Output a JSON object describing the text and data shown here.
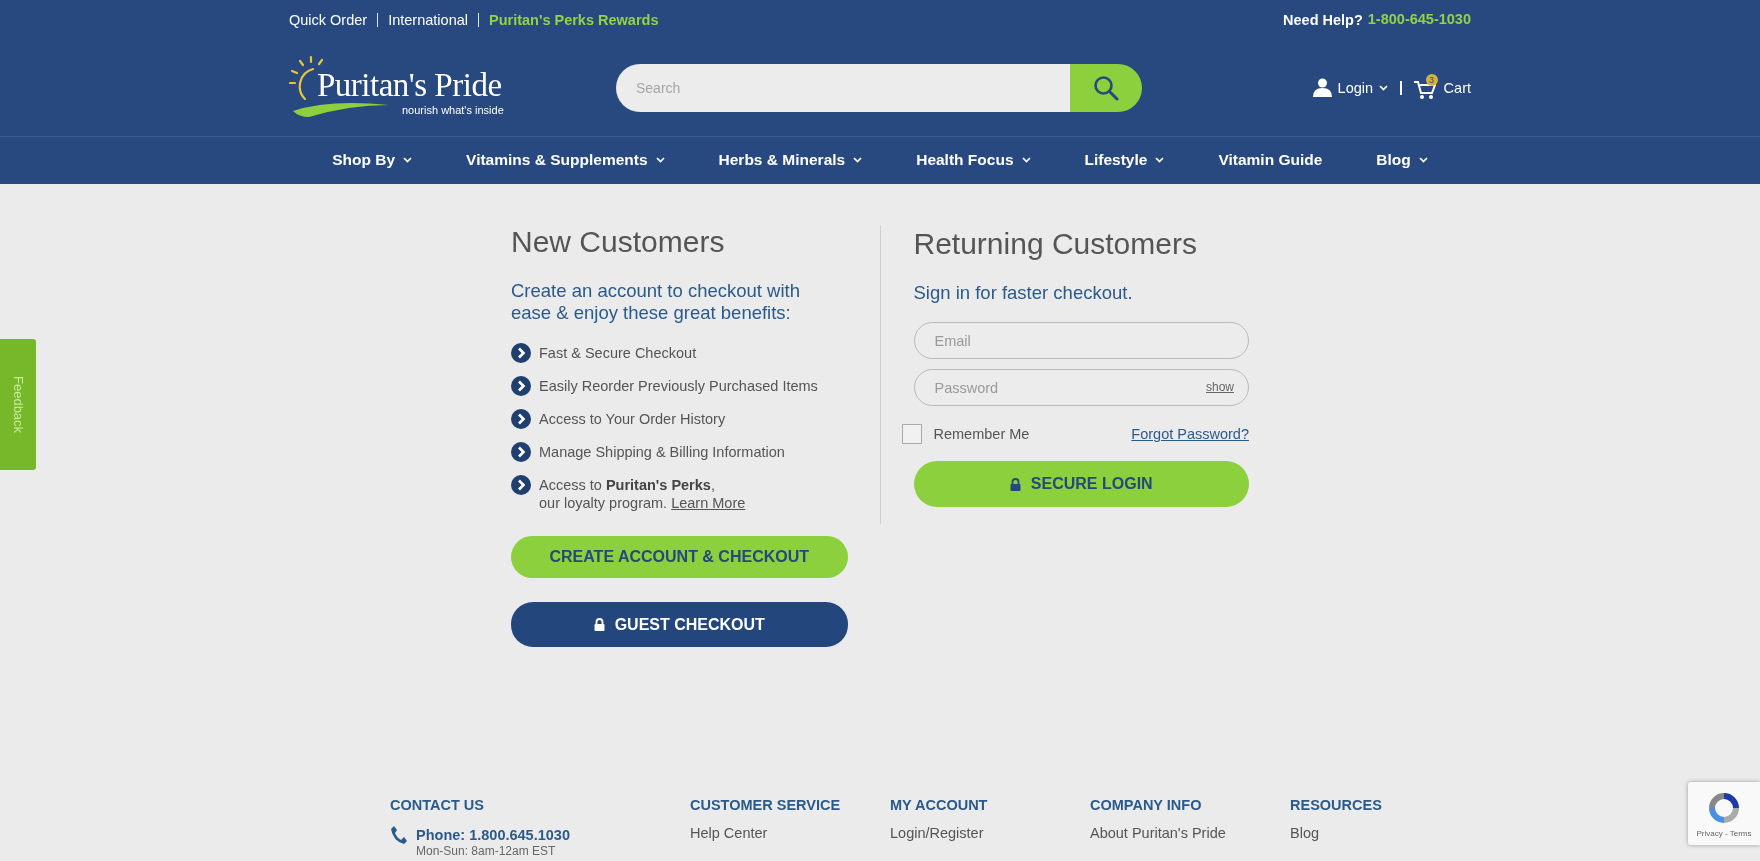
{
  "top_bar": {
    "links": [
      {
        "label": "Quick Order",
        "highlight": false
      },
      {
        "label": "International",
        "highlight": false
      },
      {
        "label": "Puritan's Perks Rewards",
        "highlight": true
      }
    ],
    "help_label": "Need Help?",
    "phone": "1-800-645-1030"
  },
  "header": {
    "logo": {
      "name": "Puritan's Pride",
      "tagline": "nourish what's inside"
    },
    "search": {
      "placeholder": "Search"
    },
    "login": "Login",
    "cart": {
      "label": "Cart",
      "badge": "3"
    }
  },
  "nav": {
    "items": [
      {
        "label": "Shop By",
        "has_menu": true
      },
      {
        "label": "Vitamins & Supplements",
        "has_menu": true
      },
      {
        "label": "Herbs & Minerals",
        "has_menu": true
      },
      {
        "label": "Health Focus",
        "has_menu": true
      },
      {
        "label": "Lifestyle",
        "has_menu": true
      },
      {
        "label": "Vitamin Guide",
        "has_menu": false
      },
      {
        "label": "Blog",
        "has_menu": true
      }
    ]
  },
  "new_customers": {
    "title": "New Customers",
    "intro": "Create an account to checkout with ease & enjoy these great benefits:",
    "benefits": [
      {
        "text": "Fast & Secure Checkout"
      },
      {
        "text": "Easily Reorder Previously Purchased Items"
      },
      {
        "text": "Access to Your Order History"
      },
      {
        "text": "Manage Shipping & Billing Information"
      },
      {
        "text": "Access to **Puritan's Perks**,\nour loyalty program.",
        "link": "Learn More"
      }
    ],
    "create_button": "CREATE ACCOUNT & CHECKOUT",
    "guest_button": "GUEST CHECKOUT"
  },
  "returning_customers": {
    "title": "Returning Customers",
    "subtitle": "Sign in for faster checkout.",
    "email": {
      "placeholder": "Email"
    },
    "password": {
      "placeholder": "Password",
      "show": "show"
    },
    "remember": {
      "label": "Remember Me",
      "checked": false
    },
    "forgot": "Forgot Password?",
    "login_button": "SECURE LOGIN"
  },
  "footer": {
    "contact": {
      "heading": "CONTACT US",
      "phone": "Phone: 1.800.645.1030",
      "hours": "Mon-Sun: 8am-12am EST"
    },
    "columns": [
      {
        "heading": "CUSTOMER SERVICE",
        "links": [
          "Help Center"
        ]
      },
      {
        "heading": "MY ACCOUNT",
        "links": [
          "Login/Register"
        ]
      },
      {
        "heading": "COMPANY INFO",
        "links": [
          "About Puritan's Pride"
        ]
      },
      {
        "heading": "RESOURCES",
        "links": [
          "Blog"
        ]
      }
    ]
  },
  "feedback": {
    "label": "Feedback"
  },
  "recaptcha": {
    "text": "Privacy - Terms"
  }
}
